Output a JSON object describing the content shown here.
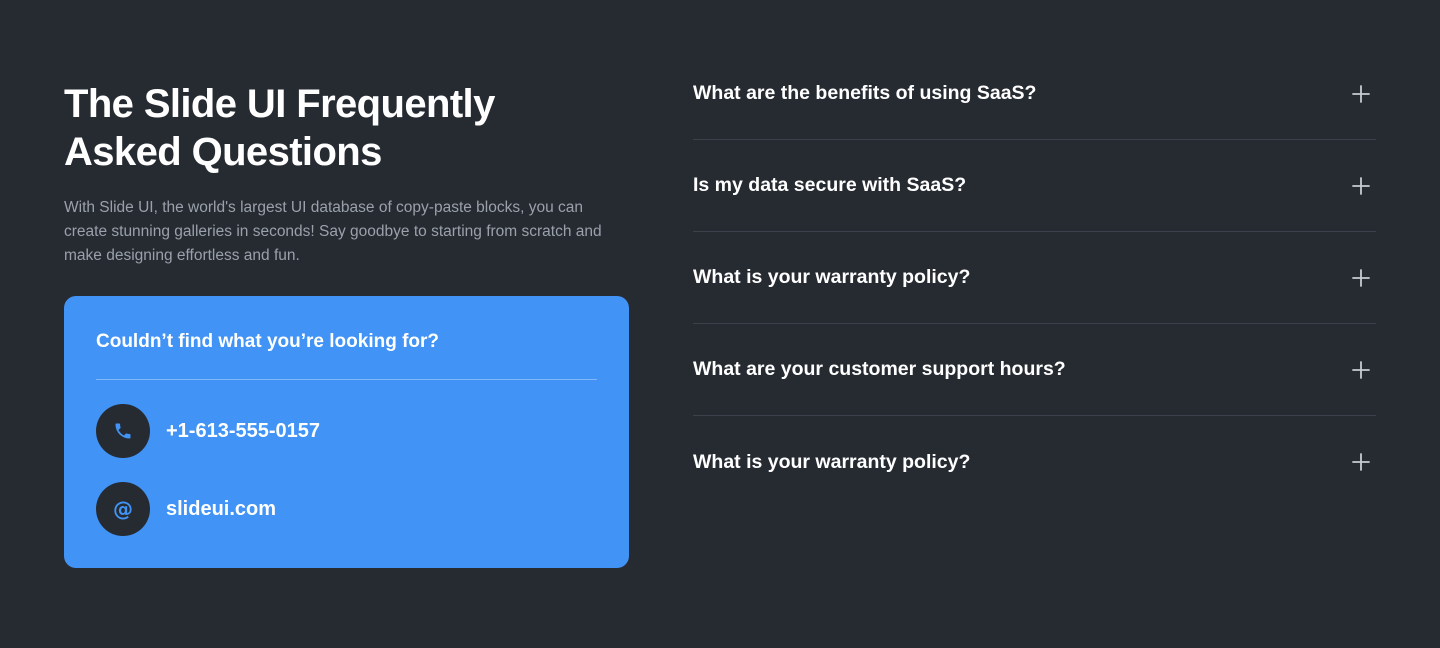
{
  "colors": {
    "background": "#262b32",
    "card": "#4193f5",
    "text": "#ffffff",
    "muted_text": "#9aa1ab",
    "divider": "#3b414a"
  },
  "intro": {
    "title": "The Slide UI Frequently Asked Questions",
    "description": "With Slide UI, the world's largest UI database of copy-paste blocks, you can create stunning galleries in seconds! Say goodbye to starting from scratch and make designing effortless and fun."
  },
  "contact": {
    "heading": "Couldn’t find what you’re looking for?",
    "phone": {
      "icon": "phone-icon",
      "label": "+1-613-555-0157"
    },
    "email": {
      "icon": "at-sign-icon",
      "glyph": "@",
      "label": "slideui.com"
    }
  },
  "faq": {
    "items": [
      {
        "question": "What are the benefits of using SaaS?",
        "icon": "plus-icon"
      },
      {
        "question": "Is my data secure with SaaS?",
        "icon": "plus-icon"
      },
      {
        "question": "What is your warranty policy?",
        "icon": "plus-icon"
      },
      {
        "question": "What are your customer support hours?",
        "icon": "plus-icon"
      },
      {
        "question": "What is your warranty policy?",
        "icon": "plus-icon"
      }
    ]
  }
}
